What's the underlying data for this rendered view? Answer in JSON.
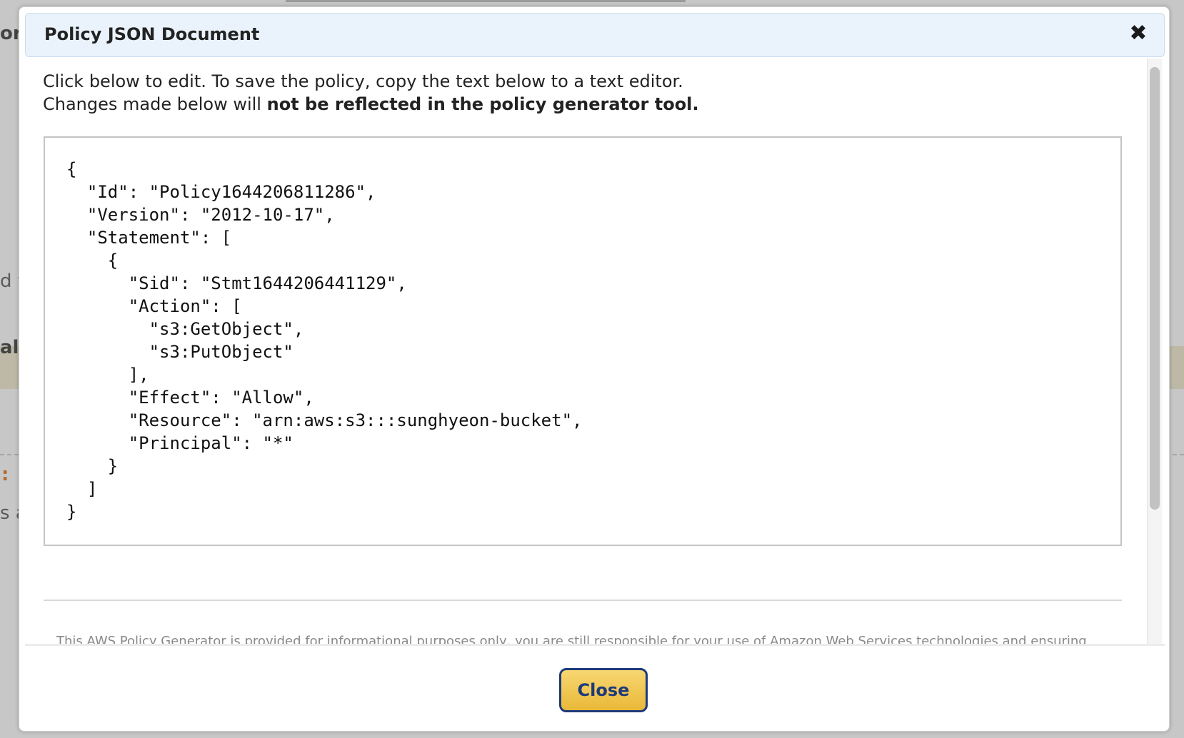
{
  "background": {
    "fragments": [
      "or",
      "d t",
      "al",
      ":",
      "s a"
    ]
  },
  "modal": {
    "title": "Policy JSON Document",
    "close_icon": "close-icon",
    "intro_line1": "Click below to edit. To save the policy, copy the text below to a text editor.",
    "intro_line2_prefix": "Changes made below will ",
    "intro_line2_bold": "not be reflected in the policy generator tool.",
    "policy_json": "{\n  \"Id\": \"Policy1644206811286\",\n  \"Version\": \"2012-10-17\",\n  \"Statement\": [\n    {\n      \"Sid\": \"Stmt1644206441129\",\n      \"Action\": [\n        \"s3:GetObject\",\n        \"s3:PutObject\"\n      ],\n      \"Effect\": \"Allow\",\n      \"Resource\": \"arn:aws:s3:::sunghyeon-bucket\",\n      \"Principal\": \"*\"\n    }\n  ]\n}",
    "disclaimer": "This AWS Policy Generator is provided for informational purposes only, you are still responsible for your use of Amazon Web Services technologies and ensuring",
    "close_button": "Close"
  },
  "colors": {
    "header_bg": "#eaf3fc",
    "button_bg": "#f0c24b",
    "button_border": "#1f3a7a"
  }
}
